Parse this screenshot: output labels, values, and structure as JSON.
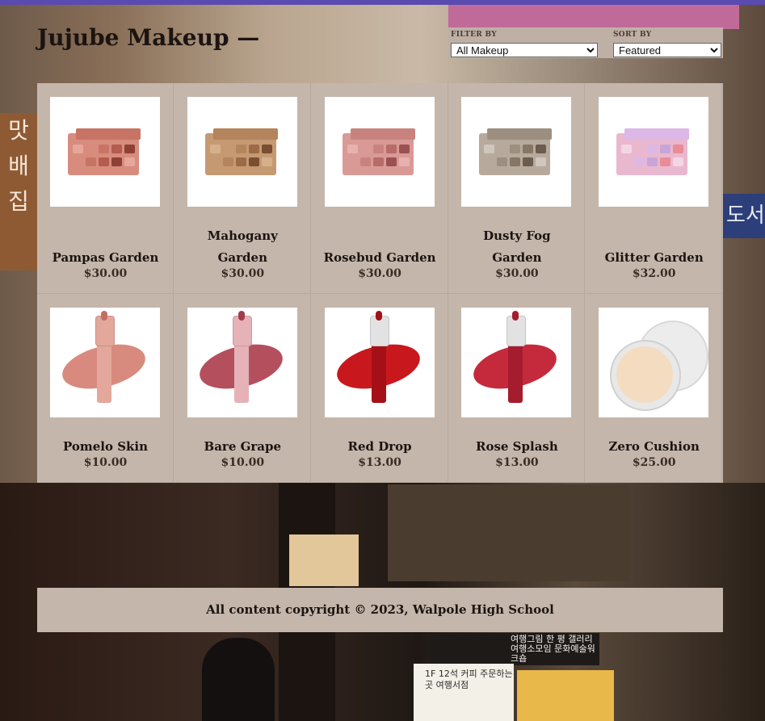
{
  "site": {
    "title": "Jujube Makeup —"
  },
  "controls": {
    "filter_label": "FILTER BY",
    "filter_value": "All Makeup",
    "sort_label": "SORT BY",
    "sort_value": "Featured"
  },
  "products": [
    {
      "name": "Pampas Garden",
      "price": "$30.00",
      "kind": "palette",
      "colors": [
        "#e6a79a",
        "#d88c7e",
        "#c87464",
        "#b45c4e",
        "#8e4034"
      ]
    },
    {
      "name": "Mahogany Garden",
      "price": "$30.00",
      "kind": "palette",
      "colors": [
        "#d6b08a",
        "#c59a72",
        "#b4845c",
        "#9c6a44",
        "#7a4e30"
      ]
    },
    {
      "name": "Rosebud Garden",
      "price": "$30.00",
      "kind": "palette",
      "colors": [
        "#e7b2ad",
        "#d99a96",
        "#c9837f",
        "#b86c69",
        "#9a5152"
      ]
    },
    {
      "name": "Dusty Fog Garden",
      "price": "$30.00",
      "kind": "palette",
      "colors": [
        "#cfc6bc",
        "#b7aa9c",
        "#9d8f80",
        "#857666",
        "#6b5c4d"
      ]
    },
    {
      "name": "Glitter Garden",
      "price": "$32.00",
      "kind": "palette",
      "colors": [
        "#f4d6e2",
        "#e9b8cf",
        "#dcb8e6",
        "#c8a5d8",
        "#e98c97"
      ]
    },
    {
      "name": "Pomelo Skin",
      "price": "$10.00",
      "kind": "tint",
      "colors": [
        "#d98a7e",
        "#e3a79b",
        "#c46d63"
      ]
    },
    {
      "name": "Bare Grape",
      "price": "$10.00",
      "kind": "tint",
      "colors": [
        "#b4505e",
        "#e5b2b8",
        "#a33d4a"
      ]
    },
    {
      "name": "Red Drop",
      "price": "$13.00",
      "kind": "tint-gloss",
      "colors": [
        "#c8181e",
        "#d6d6d6",
        "#a51016"
      ]
    },
    {
      "name": "Rose Splash",
      "price": "$13.00",
      "kind": "tint-gloss",
      "colors": [
        "#c52a3c",
        "#d6d6d6",
        "#a41c2e"
      ]
    },
    {
      "name": "Zero Cushion",
      "price": "$25.00",
      "kind": "cushion",
      "colors": [
        "#ececec",
        "#f4dcc0"
      ]
    }
  ],
  "footer": {
    "text": "All content copyright © 2023, Walpole High School"
  },
  "background": {
    "sign_left": "맛 배 집",
    "sign_right": "도서",
    "shop_sign_text": "여행그림 한 평 갤러리 여행소모임 문화예술워크숍",
    "store_sign_text": "1F 12석 커피 주문하는 곳 여행서점"
  }
}
